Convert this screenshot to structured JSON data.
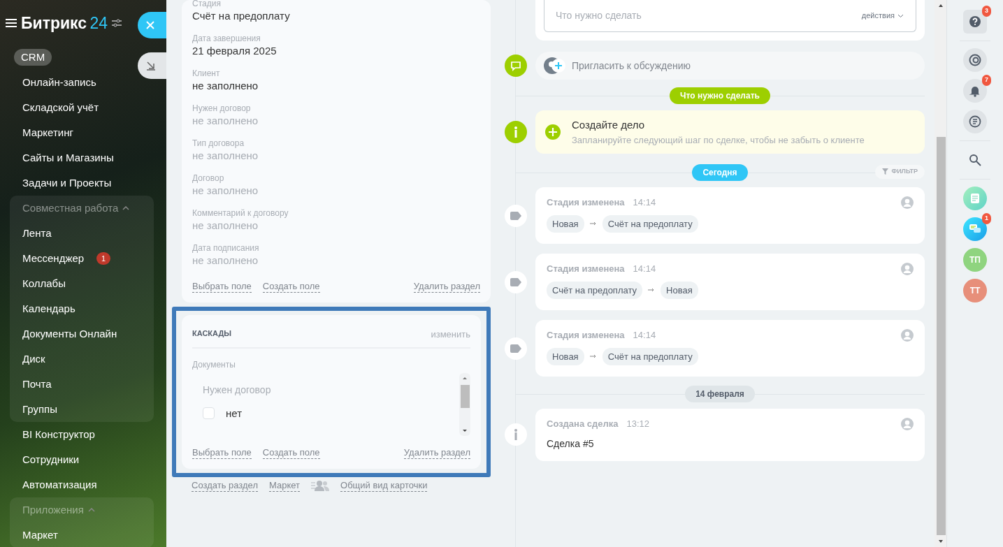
{
  "sidebar": {
    "logo": "Битрикс",
    "logo_number": "24",
    "items": [
      {
        "kind": "link",
        "label": "CRM",
        "selected": true
      },
      {
        "kind": "link",
        "label": "Онлайн-запись",
        "selected": false
      },
      {
        "kind": "link",
        "label": "Складской учёт",
        "selected": false
      },
      {
        "kind": "link",
        "label": "Маркетинг",
        "selected": false
      },
      {
        "kind": "link",
        "label": "Сайты и Магазины",
        "selected": false
      },
      {
        "kind": "link",
        "label": "Задачи и Проекты",
        "selected": false
      },
      {
        "kind": "group",
        "label": "Совместная работа",
        "expanded": true,
        "children": [
          {
            "kind": "link",
            "label": "Лента",
            "selected": false
          },
          {
            "kind": "link",
            "label": "Мессенджер",
            "selected": false,
            "counter": "1"
          },
          {
            "kind": "link",
            "label": "Коллабы",
            "selected": false
          },
          {
            "kind": "link",
            "label": "Календарь",
            "selected": false
          },
          {
            "kind": "link",
            "label": "Документы Онлайн",
            "selected": false
          },
          {
            "kind": "link",
            "label": "Диск",
            "selected": false
          },
          {
            "kind": "link",
            "label": "Почта",
            "selected": false
          },
          {
            "kind": "link",
            "label": "Группы",
            "selected": false
          }
        ]
      },
      {
        "kind": "link",
        "label": "BI Конструктор",
        "selected": false
      },
      {
        "kind": "link",
        "label": "Сотрудники",
        "selected": false
      },
      {
        "kind": "link",
        "label": "Автоматизация",
        "selected": false
      },
      {
        "kind": "group",
        "label": "Приложения",
        "expanded": true,
        "children": [
          {
            "kind": "link",
            "label": "Маркет",
            "selected": false
          }
        ]
      }
    ]
  },
  "main_section": {
    "fields": [
      {
        "label": "Стадия",
        "value": "Счёт на предоплату",
        "empty": false
      },
      {
        "label": "Дата завершения",
        "value": "21 февраля 2025",
        "empty": false
      },
      {
        "label": "Клиент",
        "value": "не заполнено",
        "empty": false
      },
      {
        "label": "Нужен договор",
        "value": "не заполнено",
        "empty": true
      },
      {
        "label": "Тип договора",
        "value": "не заполнено",
        "empty": true
      },
      {
        "label": "Договор",
        "value": "не заполнено",
        "empty": true
      },
      {
        "label": "Комментарий к договору",
        "value": "не заполнено",
        "empty": true
      },
      {
        "label": "Дата подписания",
        "value": "не заполнено",
        "empty": true
      }
    ],
    "links": [
      "Выбрать поле",
      "Создать поле"
    ],
    "delete": "Удалить раздел"
  },
  "cascade_section": {
    "title": "КАСКАДЫ",
    "edit": "изменить",
    "group_label": "Документы",
    "field_label": "Нужен договор",
    "options": [
      {
        "label": "нет",
        "checked": false
      }
    ],
    "links": [
      "Выбрать поле",
      "Создать поле"
    ],
    "delete": "Удалить раздел"
  },
  "footer_links": [
    {
      "kind": "link",
      "label": "Создать раздел"
    },
    {
      "kind": "link",
      "label": "Маркет"
    },
    {
      "kind": "icon-link",
      "label": "Общий вид карточки"
    }
  ],
  "timeline": [
    {
      "kind": "composer",
      "placeholder": "Что нужно сделать",
      "actions": "действия"
    },
    {
      "kind": "invite",
      "label": "Пригласить к обсуждению"
    },
    {
      "kind": "divider",
      "label": "Что нужно сделать",
      "color": "#9dcf00"
    },
    {
      "kind": "todo",
      "title": "Создайте дело",
      "text": "Запланируйте следующий шаг по сделке, чтобы не забыть о клиенте"
    },
    {
      "kind": "divider",
      "label": "Сегодня",
      "color": "#2fc6f6",
      "filter": "ФИЛЬТР"
    },
    {
      "kind": "stage",
      "title": "Стадия изменена",
      "time": "14:14",
      "from": "Новая",
      "to": "Счёт на предоплату"
    },
    {
      "kind": "stage",
      "title": "Стадия изменена",
      "time": "14:14",
      "from": "Счёт на предоплату",
      "to": "Новая"
    },
    {
      "kind": "stage",
      "title": "Стадия изменена",
      "time": "14:14",
      "from": "Новая",
      "to": "Счёт на предоплату"
    },
    {
      "kind": "divider",
      "label": "14 февраля",
      "color": "#dfe5e8"
    },
    {
      "kind": "created",
      "title": "Создана сделка",
      "time": "13:12",
      "text": "Сделка #5"
    }
  ],
  "right_bar": [
    {
      "kind": "help",
      "counter": "3"
    },
    {
      "kind": "sep"
    },
    {
      "kind": "copilot"
    },
    {
      "kind": "bell",
      "counter": "7"
    },
    {
      "kind": "chats"
    },
    {
      "kind": "sep"
    },
    {
      "kind": "search"
    },
    {
      "kind": "sep"
    },
    {
      "kind": "news"
    },
    {
      "kind": "messenger",
      "counter": "1"
    },
    {
      "kind": "avatar",
      "initials": "ТП",
      "color": "#8fd47f"
    },
    {
      "kind": "avatar",
      "initials": "ТТ",
      "color": "#e78f7a"
    }
  ]
}
